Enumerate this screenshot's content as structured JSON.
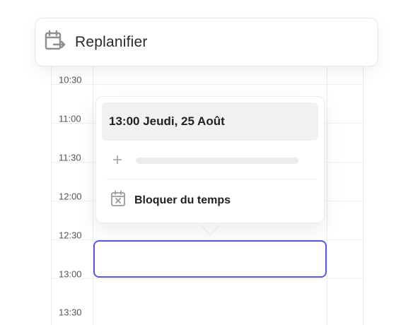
{
  "header": {
    "title": "Replanifier",
    "icon": "calendar-reschedule-icon"
  },
  "calendar": {
    "times": [
      "10:30",
      "11:00",
      "11:30",
      "12:00",
      "12:30",
      "13:00",
      "13:30"
    ]
  },
  "popover": {
    "datetime": "13:00 Jeudi, 25 Août",
    "add_icon": "plus-icon",
    "block_label": "Bloquer du temps",
    "block_icon": "calendar-x-icon"
  },
  "colors": {
    "accent": "#5a57e0"
  }
}
